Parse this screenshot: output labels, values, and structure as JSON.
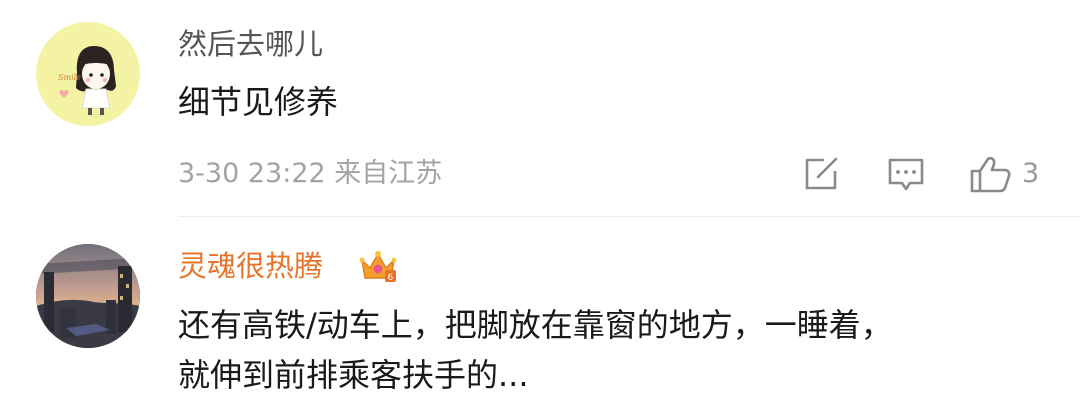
{
  "comments": [
    {
      "username": "然后去哪儿",
      "avatar": "smile-girl-avatar",
      "text": "细节见修养",
      "meta": "3-30 23:22 来自江苏",
      "like_count": "3"
    },
    {
      "username": "灵魂很热腾",
      "badge": "crown-icon",
      "avatar": "city-sunset-avatar",
      "text_lines": [
        "还有高铁/动车上，把脚放在靠窗的地方，一睡着，",
        "就伸到前排乘客扶手的..."
      ]
    }
  ],
  "icons": {
    "share": "share-icon",
    "reply": "comment-icon",
    "like": "thumbs-up-icon"
  },
  "colors": {
    "vip_name": "#e8742b",
    "meta_gray": "#a3a3a3"
  }
}
